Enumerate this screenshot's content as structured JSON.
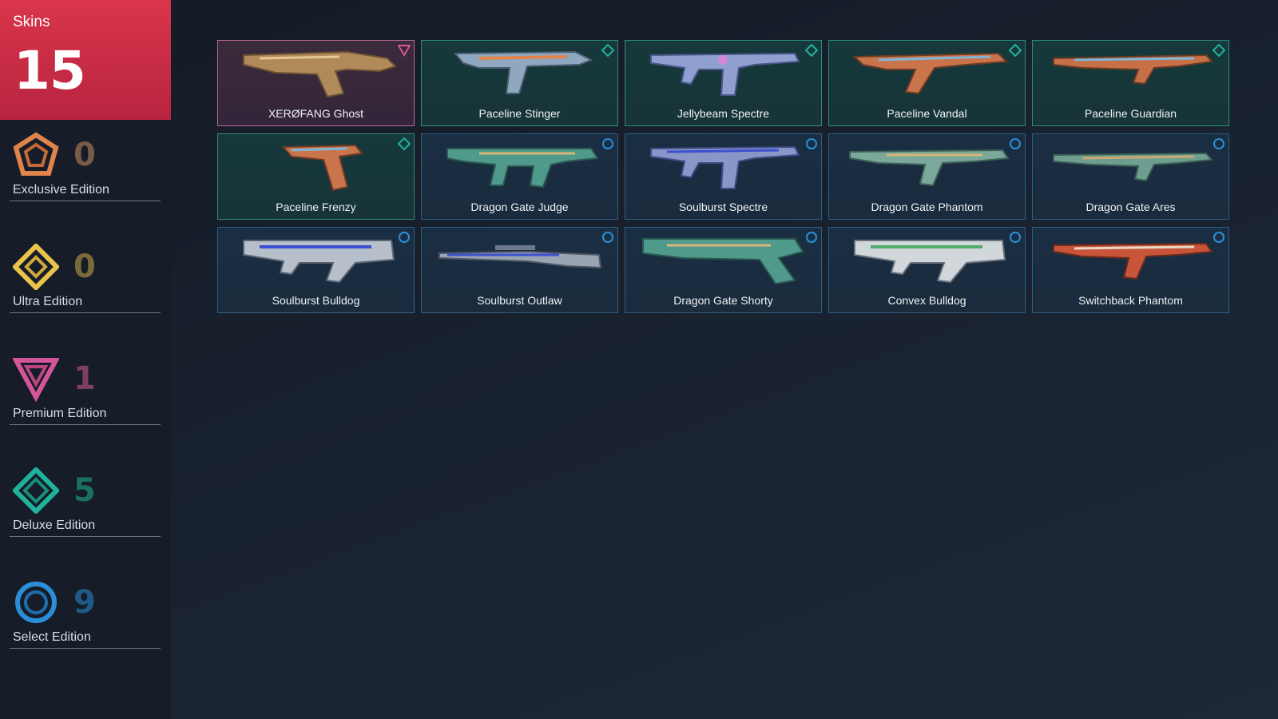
{
  "header": {
    "label": "Skins",
    "count": "15"
  },
  "tiers": [
    {
      "id": "exclusive",
      "label": "Exclusive Edition",
      "count": "0",
      "icon": "exclusive-pentagon-icon",
      "color": "#e0844a",
      "count_color": "#7a5a45"
    },
    {
      "id": "ultra",
      "label": "Ultra Edition",
      "count": "0",
      "icon": "ultra-diamond-icon",
      "color": "#e8c44a",
      "count_color": "#7a6a3a"
    },
    {
      "id": "premium",
      "label": "Premium Edition",
      "count": "1",
      "icon": "premium-triangle-icon",
      "color": "#d5559b",
      "count_color": "#7d3e60"
    },
    {
      "id": "deluxe",
      "label": "Deluxe Edition",
      "count": "5",
      "icon": "deluxe-rhombus-icon",
      "color": "#1fb39c",
      "count_color": "#1b6e62"
    },
    {
      "id": "select",
      "label": "Select Edition",
      "count": "9",
      "icon": "select-circle-icon",
      "color": "#2a8fd8",
      "count_color": "#1f5a86"
    }
  ],
  "skins": [
    {
      "name": "XERØFANG Ghost",
      "tier": "premium",
      "icon": "ghost-pistol-icon"
    },
    {
      "name": "Paceline Stinger",
      "tier": "deluxe",
      "icon": "stinger-smg-icon"
    },
    {
      "name": "Jellybeam Spectre",
      "tier": "deluxe",
      "icon": "spectre-smg-icon"
    },
    {
      "name": "Paceline Vandal",
      "tier": "deluxe",
      "icon": "vandal-rifle-icon"
    },
    {
      "name": "Paceline Guardian",
      "tier": "deluxe",
      "icon": "guardian-rifle-icon"
    },
    {
      "name": "Paceline Frenzy",
      "tier": "deluxe",
      "icon": "frenzy-pistol-icon"
    },
    {
      "name": "Dragon Gate Judge",
      "tier": "select",
      "icon": "judge-shotgun-icon"
    },
    {
      "name": "Soulburst Spectre",
      "tier": "select",
      "icon": "spectre-smg-icon"
    },
    {
      "name": "Dragon Gate Phantom",
      "tier": "select",
      "icon": "phantom-rifle-icon"
    },
    {
      "name": "Dragon Gate Ares",
      "tier": "select",
      "icon": "ares-lmg-icon"
    },
    {
      "name": "Soulburst Bulldog",
      "tier": "select",
      "icon": "bulldog-rifle-icon"
    },
    {
      "name": "Soulburst Outlaw",
      "tier": "select",
      "icon": "outlaw-sniper-icon"
    },
    {
      "name": "Dragon Gate Shorty",
      "tier": "select",
      "icon": "shorty-shotgun-icon"
    },
    {
      "name": "Convex Bulldog",
      "tier": "select",
      "icon": "bulldog-rifle-icon"
    },
    {
      "name": "Switchback Phantom",
      "tier": "select",
      "icon": "phantom-rifle-icon"
    }
  ]
}
